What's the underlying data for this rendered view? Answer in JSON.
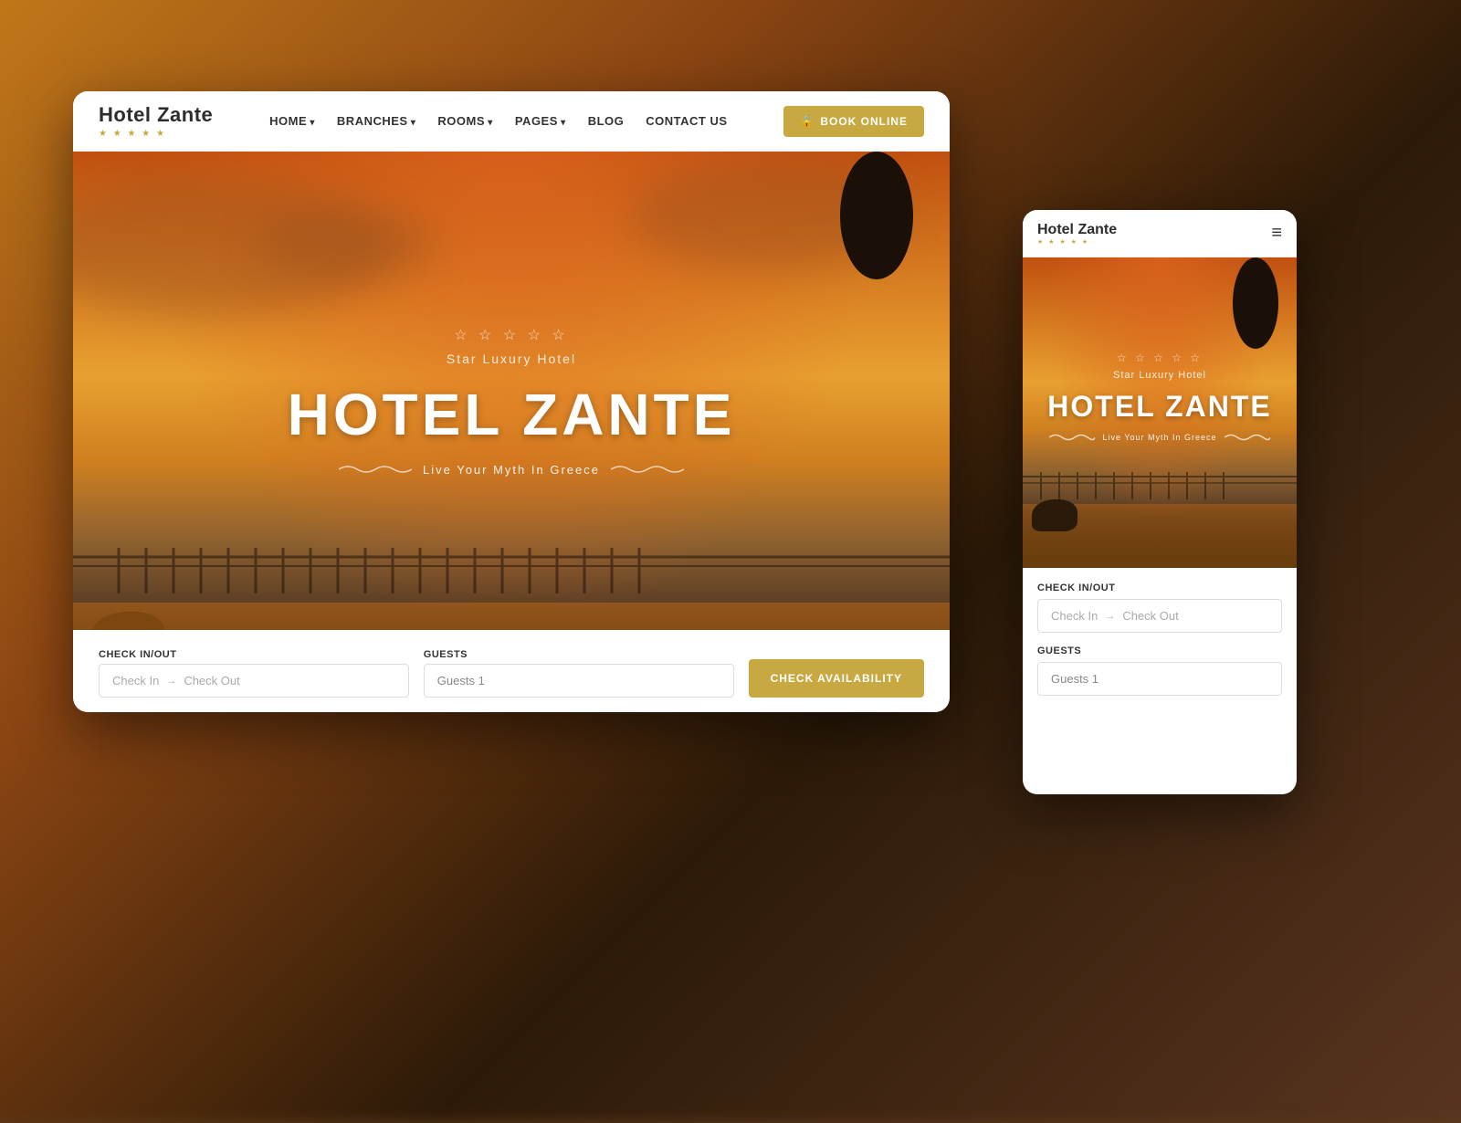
{
  "background": {
    "color": "#5a3a1a"
  },
  "desktop": {
    "navbar": {
      "brand": "Hotel Zante",
      "stars": "★ ★ ★ ★ ★",
      "nav_items": [
        {
          "label": "HOME",
          "has_dropdown": true
        },
        {
          "label": "BRANCHES",
          "has_dropdown": true
        },
        {
          "label": "ROOMS",
          "has_dropdown": true
        },
        {
          "label": "PAGES",
          "has_dropdown": true
        },
        {
          "label": "BLOG",
          "has_dropdown": false
        },
        {
          "label": "CONTACT US",
          "has_dropdown": false
        }
      ],
      "book_btn": "BOOK ONLINE",
      "book_icon": "🔒"
    },
    "hero": {
      "stars": "☆ ☆ ☆ ☆ ☆",
      "subtitle": "Star Luxury Hotel",
      "title": "HOTEL ZANTE",
      "tagline": "Live Your Myth In Greece"
    },
    "booking_bar": {
      "checkin_label": "Check In/Out",
      "checkin_placeholder": "Check In",
      "checkout_placeholder": "Check Out",
      "guests_label": "Guests",
      "guests_value": "Guests 1",
      "cta": "CHECK AVAILABILITY"
    }
  },
  "mobile": {
    "navbar": {
      "brand": "Hotel Zante",
      "stars": "★ ★ ★ ★ ★",
      "menu_icon": "≡"
    },
    "hero": {
      "stars": "☆ ☆ ☆ ☆ ☆",
      "subtitle": "Star Luxury Hotel",
      "title": "HOTEL ZANTE",
      "tagline": "Live Your Myth In Greece"
    },
    "booking": {
      "checkin_label": "Check In/Out",
      "checkin_placeholder": "Check In",
      "checkout_placeholder": "Check Out",
      "guests_label": "Guests",
      "guests_value": "Guests 1"
    }
  }
}
